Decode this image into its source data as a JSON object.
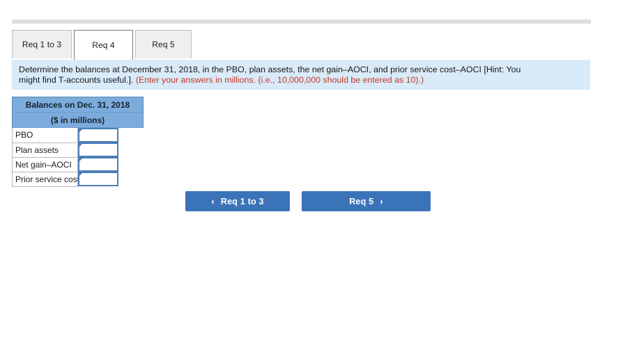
{
  "top_bar": {
    "name": "divider-bar",
    "color": "#dedede"
  },
  "tabs": [
    {
      "label": "Req 1 to 3",
      "active": false
    },
    {
      "label": "Req 4",
      "active": true
    },
    {
      "label": "Req 5",
      "active": false
    }
  ],
  "instruction": {
    "line1": "Determine the balances at December 31, 2018, in the PBO, plan assets, the net gain–AOCI, and prior service cost–AOCI [Hint: You",
    "line2_main": "might find T-accounts useful.]. ",
    "line2_hint": "(Enter your answers in millions. (i.e., 10,000,000 should be entered as 10).)",
    "background": "#d9eaf8",
    "hint_color": "#c0392b"
  },
  "answer_table": {
    "header_line1": "Balances on Dec. 31, 2018",
    "header_line2": "($ in millions)",
    "header_color": "#7cacdc",
    "rows": [
      {
        "label": "PBO",
        "value": "",
        "placeholder": ""
      },
      {
        "label": "Plan assets",
        "value": "",
        "placeholder": ""
      },
      {
        "label": "Net gain–AOCI",
        "value": "",
        "placeholder": ""
      },
      {
        "label": "Prior service cost–AOCI",
        "value": "",
        "placeholder": ""
      }
    ]
  },
  "nav": {
    "prev_label": "Req 1 to 3",
    "prev_icon": "‹",
    "next_label": "Req 5",
    "next_icon": "›",
    "button_color": "#3b73b9"
  }
}
